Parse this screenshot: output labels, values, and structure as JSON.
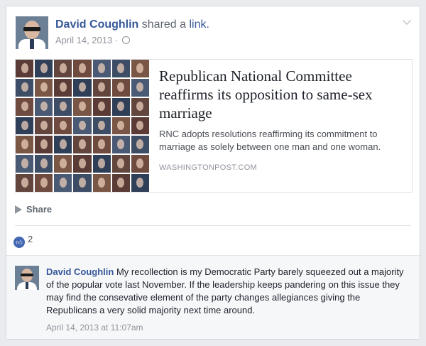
{
  "post": {
    "author": "David Coughlin",
    "action": "shared a",
    "action_link": "link.",
    "date": "April 14, 2013 ·",
    "globe_icon": "globe-icon"
  },
  "link_preview": {
    "title": "Republican National Committee reaffirms its opposition to same-sex marriage",
    "description": "RNC adopts resolutions reaffirming its commitment to marriage as solely between one man and one woman.",
    "domain": "WASHINGTONPOST.COM"
  },
  "actions": {
    "share_label": "Share"
  },
  "reactions": {
    "like_count": "2"
  },
  "comment": {
    "author": "David Coughlin",
    "text": "My recollection is my Democratic Party barely squeezed out a majority of the popular vote last November. If the leadership keeps pandering on this issue they may find the consevative element of the party changes allegiances giving the Republicans a very solid majority next time around.",
    "timestamp": "April 14, 2013 at 11:07am"
  },
  "colors": {
    "link_blue": "#365899",
    "meta_gray": "#90949c",
    "like_blue": "#4267b2"
  }
}
